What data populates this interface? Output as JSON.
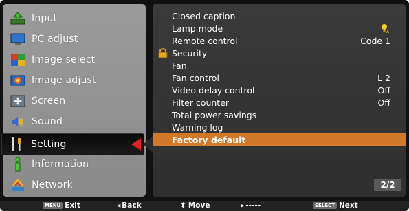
{
  "left_menu": [
    {
      "label": "Input",
      "icon": "input-icon"
    },
    {
      "label": "PC adjust",
      "icon": "pc-adjust-icon"
    },
    {
      "label": "Image select",
      "icon": "image-select-icon"
    },
    {
      "label": "Image adjust",
      "icon": "image-adjust-icon"
    },
    {
      "label": "Screen",
      "icon": "screen-icon"
    },
    {
      "label": "Sound",
      "icon": "sound-icon"
    },
    {
      "label": "Setting",
      "icon": "setting-icon",
      "selected": true
    },
    {
      "label": "Information",
      "icon": "information-icon"
    },
    {
      "label": "Network",
      "icon": "network-icon"
    }
  ],
  "settings_list": [
    {
      "label": "Closed caption",
      "value": ""
    },
    {
      "label": "Lamp mode",
      "value": "",
      "icon": "lamp-icon"
    },
    {
      "label": "Remote control",
      "value": "Code 1"
    },
    {
      "label": "Security",
      "value": "",
      "icon": "lock-icon"
    },
    {
      "label": "Fan",
      "value": ""
    },
    {
      "label": "Fan control",
      "value": "L 2"
    },
    {
      "label": "Video delay control",
      "value": "Off"
    },
    {
      "label": "Filter counter",
      "value": "Off"
    },
    {
      "label": "Total power savings",
      "value": ""
    },
    {
      "label": "Warning log",
      "value": ""
    },
    {
      "label": "Factory default",
      "value": "",
      "highlighted": true
    }
  ],
  "page_indicator": "2/2",
  "bottom_bar": {
    "menu_key": "MENU",
    "exit": "Exit",
    "back": "Back",
    "move": "Move",
    "next_dashes": "-----",
    "select_key": "SELECT",
    "next": "Next"
  },
  "colors": {
    "highlight": "#d2782a",
    "selected_arrow": "#e3202a",
    "panel_left": "#9b9b9b",
    "panel_right": "#353535"
  }
}
